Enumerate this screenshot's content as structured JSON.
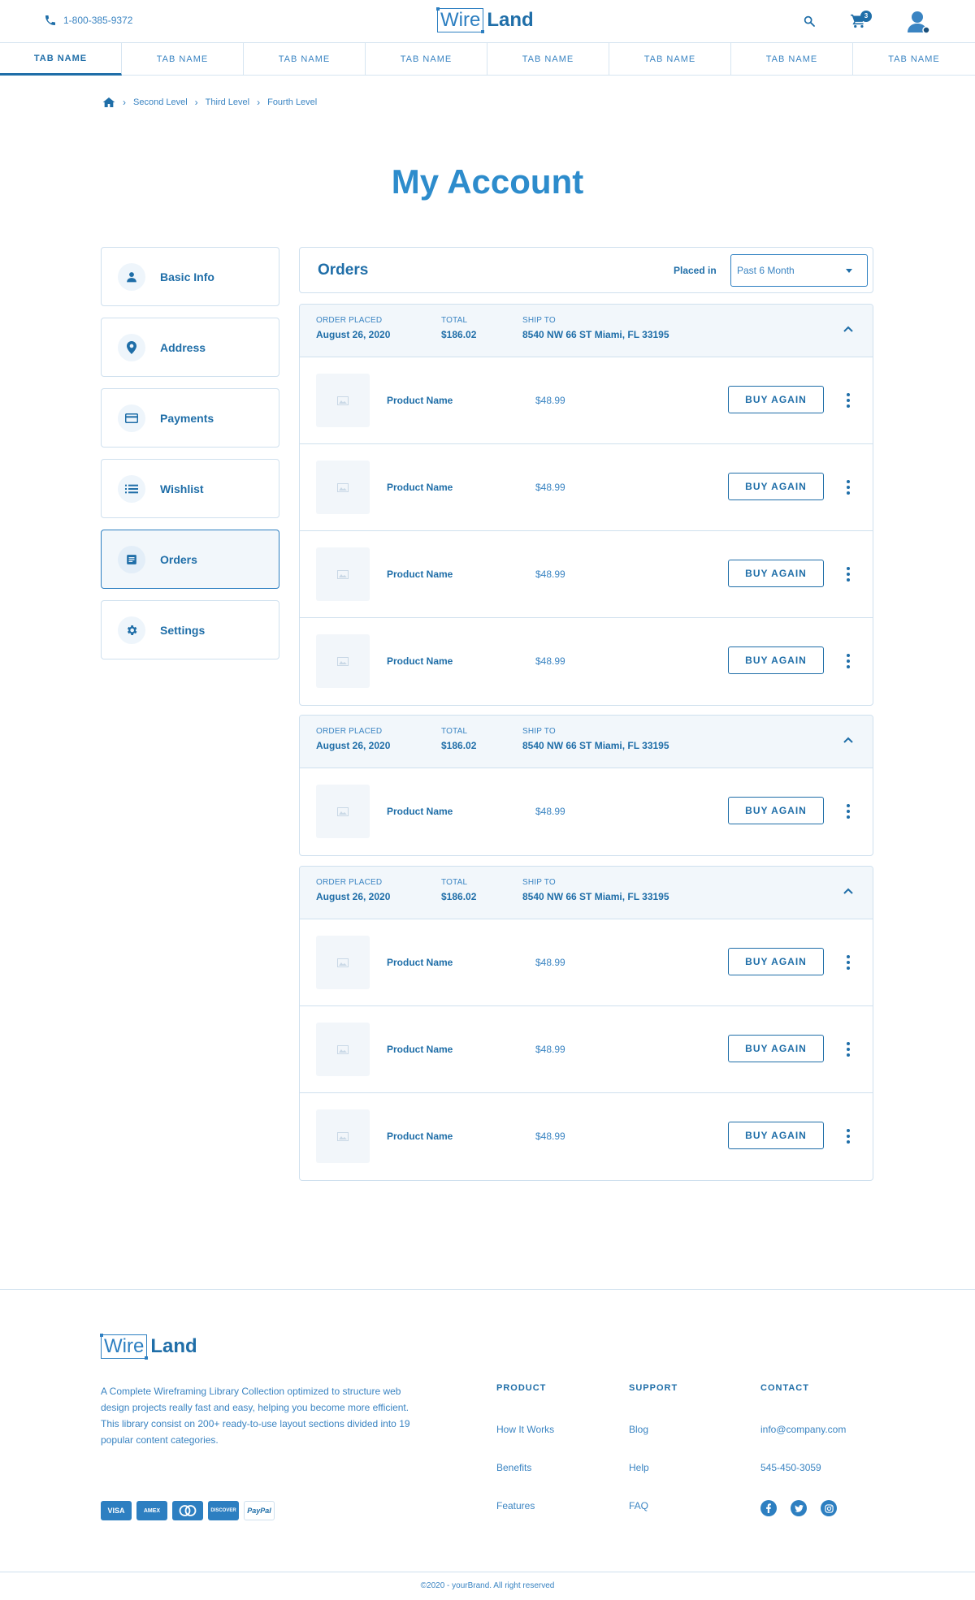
{
  "header": {
    "phone": "1-800-385-9372",
    "logo_wire": "Wire",
    "logo_land": "Land",
    "cart_count": "3"
  },
  "tabs": [
    {
      "label": "TAB NAME"
    },
    {
      "label": "TAB NAME"
    },
    {
      "label": "TAB NAME"
    },
    {
      "label": "TAB NAME"
    },
    {
      "label": "TAB NAME"
    },
    {
      "label": "TAB NAME"
    },
    {
      "label": "TAB NAME"
    },
    {
      "label": "TAB NAME"
    }
  ],
  "breadcrumb": [
    "Second Level",
    "Third Level",
    "Fourth Level"
  ],
  "page_title": "My Account",
  "sidebar": [
    {
      "label": "Basic Info",
      "icon": "person-icon"
    },
    {
      "label": "Address",
      "icon": "location-pin-icon"
    },
    {
      "label": "Payments",
      "icon": "credit-card-icon"
    },
    {
      "label": "Wishlist",
      "icon": "list-icon"
    },
    {
      "label": "Orders",
      "icon": "document-icon"
    },
    {
      "label": "Settings",
      "icon": "gear-icon"
    }
  ],
  "orders": {
    "title": "Orders",
    "filter_label": "Placed in",
    "filter_value": "Past 6 Month",
    "labels": {
      "placed": "ORDER PLACED",
      "total": "TOTAL",
      "ship": "SHIP TO",
      "buy_again": "BUY AGAIN"
    },
    "groups": [
      {
        "date": "August 26, 2020",
        "total": "$186.02",
        "ship_to": "8540 NW 66 ST Miami, FL 33195",
        "items": [
          {
            "name": "Product Name",
            "price": "$48.99"
          },
          {
            "name": "Product Name",
            "price": "$48.99"
          },
          {
            "name": "Product Name",
            "price": "$48.99"
          },
          {
            "name": "Product Name",
            "price": "$48.99"
          }
        ]
      },
      {
        "date": "August 26, 2020",
        "total": "$186.02",
        "ship_to": "8540 NW 66 ST Miami, FL 33195",
        "items": [
          {
            "name": "Product Name",
            "price": "$48.99"
          }
        ]
      },
      {
        "date": "August 26, 2020",
        "total": "$186.02",
        "ship_to": "8540 NW 66 ST Miami, FL 33195",
        "items": [
          {
            "name": "Product Name",
            "price": "$48.99"
          },
          {
            "name": "Product Name",
            "price": "$48.99"
          },
          {
            "name": "Product Name",
            "price": "$48.99"
          }
        ]
      }
    ]
  },
  "footer": {
    "description": "A Complete Wireframing Library Collection optimized to structure web design projects really fast and easy, helping you become more efficient. This library consist on 200+ ready-to-use layout sections divided into 19 popular content categories.",
    "cards": [
      "VISA",
      "AMEX",
      "MC",
      "DISCOVER",
      "PayPal"
    ],
    "columns": [
      {
        "title": "PRODUCT",
        "links": [
          "How It Works",
          "Benefits",
          "Features"
        ]
      },
      {
        "title": "SUPPORT",
        "links": [
          "Blog",
          "Help",
          "FAQ"
        ]
      },
      {
        "title": "CONTACT",
        "links": [
          "info@company.com",
          "545-450-3059"
        ]
      }
    ],
    "socials": [
      "facebook-icon",
      "twitter-icon",
      "instagram-icon"
    ],
    "copyright": "©2020 - yourBrand. All right reserved"
  },
  "colors": {
    "primary": "#1f6ea8",
    "accent": "#2d8ccc",
    "border": "#cfe0ee",
    "panel": "#f2f7fb"
  }
}
